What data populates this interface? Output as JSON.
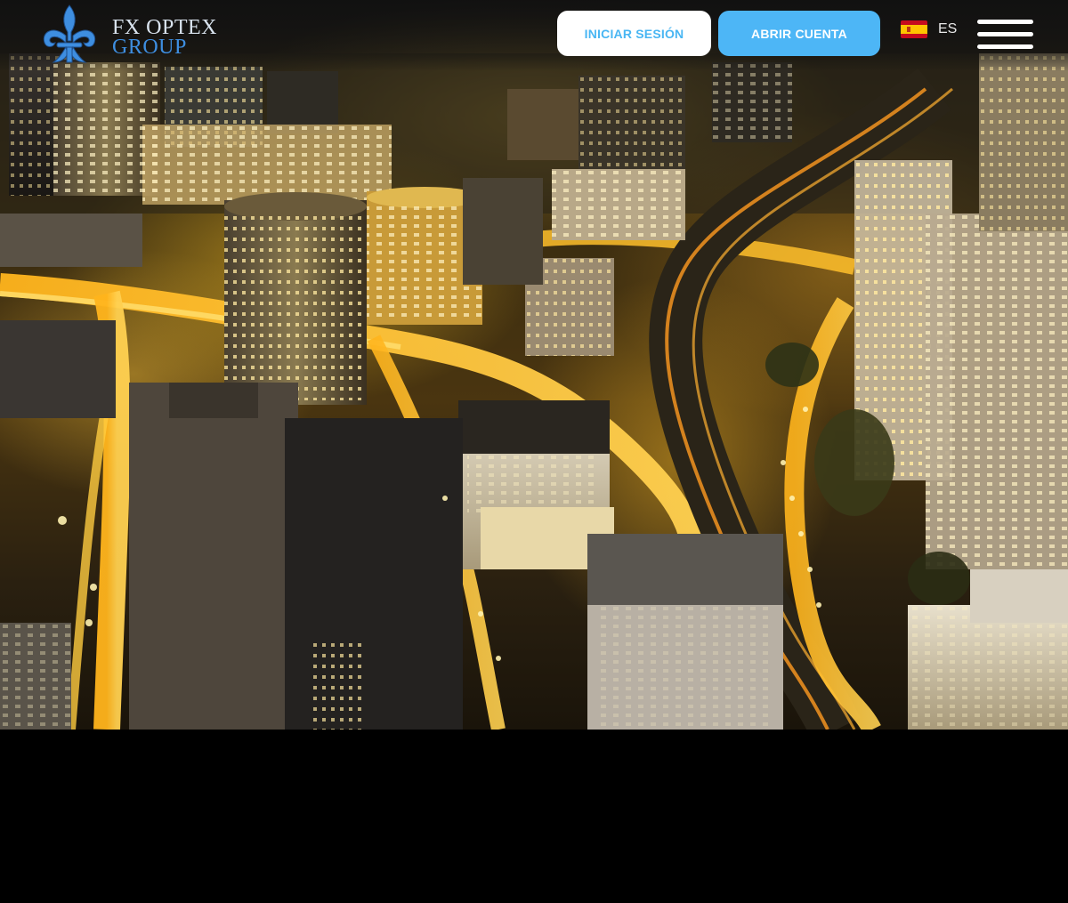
{
  "brand": {
    "line1": "FX OPTEX",
    "line2": "GROUP",
    "logo_icon": "fleur-de-lis-icon",
    "color_primary": "#3e8ee0",
    "color_text": "#d9e3ee"
  },
  "header": {
    "login_label": "INICIAR SESIÓN",
    "open_account_label": "ABRIR CUENTA",
    "language": {
      "flag_icon": "spain-flag-icon",
      "code": "ES"
    },
    "menu_icon": "hamburger-menu-icon"
  },
  "hero": {
    "media": "night-city-aerial-video"
  },
  "colors": {
    "accent": "#4db6f6",
    "login_text": "#49b6f3",
    "background": "#000000"
  }
}
